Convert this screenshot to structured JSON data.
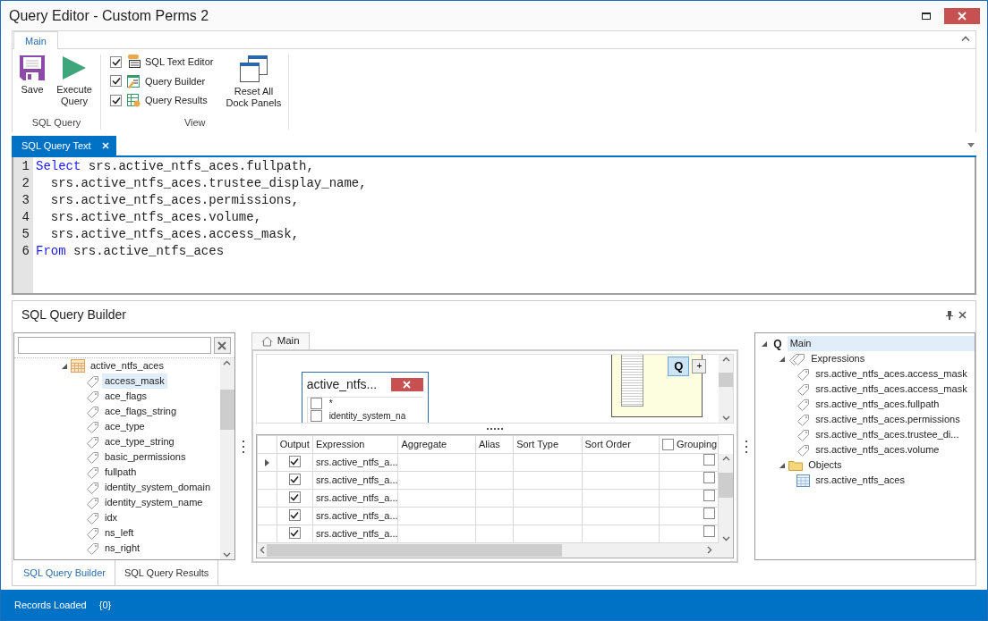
{
  "window": {
    "title": "Query Editor - Custom Perms 2"
  },
  "ribbon": {
    "tabs": [
      {
        "label": "Main",
        "selected": true
      }
    ],
    "groups": [
      {
        "label": "SQL Query",
        "items": [
          {
            "kind": "large",
            "label": "Save"
          },
          {
            "kind": "large",
            "label": "Execute Query"
          }
        ]
      },
      {
        "label": "View",
        "items": [
          {
            "kind": "check",
            "label": "SQL Text Editor",
            "checked": true
          },
          {
            "kind": "check",
            "label": "Query Builder",
            "checked": true
          },
          {
            "kind": "check",
            "label": "Query Results",
            "checked": true
          },
          {
            "kind": "large",
            "label": "Reset All Dock Panels"
          }
        ]
      }
    ]
  },
  "document_tabs": [
    {
      "label": "SQL Query Text",
      "selected": true
    }
  ],
  "sql_editor": {
    "lines": [
      {
        "number": "1",
        "keyword": "Select",
        "code": " srs.active_ntfs_aces.fullpath,"
      },
      {
        "number": "2",
        "code": "  srs.active_ntfs_aces.trustee_display_name,"
      },
      {
        "number": "3",
        "code": "  srs.active_ntfs_aces.permissions,"
      },
      {
        "number": "4",
        "code": "  srs.active_ntfs_aces.volume,"
      },
      {
        "number": "5",
        "code": "  srs.active_ntfs_aces.access_mask,"
      },
      {
        "number": "6",
        "keyword": "From",
        "code": " srs.active_ntfs_aces"
      }
    ]
  },
  "query_builder": {
    "title": "SQL Query Builder",
    "schema_tree": {
      "label": "active_ntfs_aces",
      "expanded": true,
      "children": [
        {
          "label": "access_mask",
          "selected": true
        },
        {
          "label": "ace_flags",
          "selected": false
        },
        {
          "label": "ace_flags_string",
          "selected": false
        },
        {
          "label": "ace_type",
          "selected": false
        },
        {
          "label": "ace_type_string",
          "selected": false
        },
        {
          "label": "basic_permissions",
          "selected": false
        },
        {
          "label": "fullpath",
          "selected": false
        },
        {
          "label": "identity_system_domain",
          "selected": false
        },
        {
          "label": "identity_system_name",
          "selected": false
        },
        {
          "label": "idx",
          "selected": false
        },
        {
          "label": "ns_left",
          "selected": false
        },
        {
          "label": "ns_right",
          "selected": false
        }
      ]
    },
    "canvas_tabs": [
      {
        "label": "Main",
        "selected": true
      }
    ],
    "diagram_table": {
      "title": "active_ntfs...",
      "fields": [
        {
          "label": "*",
          "checked": false
        },
        {
          "label": "identity_system_na",
          "checked": false
        }
      ]
    },
    "navigator": {
      "query_button": "Q",
      "add_button": "+"
    },
    "grid": {
      "columns": [
        "Output",
        "Expression",
        "Aggregate",
        "Alias",
        "Sort Type",
        "Sort Order",
        "Grouping"
      ],
      "grouping_checked": false,
      "rows": [
        {
          "current": true,
          "output": true,
          "expression": "srs.active_ntfs_a...",
          "grouping": false
        },
        {
          "current": false,
          "output": true,
          "expression": "srs.active_ntfs_a...",
          "grouping": false
        },
        {
          "current": false,
          "output": true,
          "expression": "srs.active_ntfs_a...",
          "grouping": false
        },
        {
          "current": false,
          "output": true,
          "expression": "srs.active_ntfs_a...",
          "grouping": false
        },
        {
          "current": false,
          "output": true,
          "expression": "srs.active_ntfs_a...",
          "grouping": false
        }
      ]
    },
    "query_tree": {
      "icon_text": "Q",
      "label": "Main",
      "selected": true,
      "expanded": true,
      "children": [
        {
          "kind": "expressions",
          "label": "Expressions",
          "expanded": true,
          "children": [
            {
              "label": "srs.active_ntfs_aces.access_mask"
            },
            {
              "label": "srs.active_ntfs_aces.access_mask"
            },
            {
              "label": "srs.active_ntfs_aces.fullpath"
            },
            {
              "label": "srs.active_ntfs_aces.permissions"
            },
            {
              "label": "srs.active_ntfs_aces.trustee_di..."
            },
            {
              "label": "srs.active_ntfs_aces.volume"
            }
          ]
        },
        {
          "kind": "objects",
          "label": "Objects",
          "expanded": true,
          "children": [
            {
              "label": "srs.active_ntfs_aces"
            }
          ]
        }
      ]
    },
    "bottom_tabs": [
      {
        "label": "SQL Query Builder",
        "selected": true
      },
      {
        "label": "SQL Query Results",
        "selected": false
      }
    ]
  },
  "status_bar": {
    "label": "Records Loaded",
    "value": "{0}"
  }
}
